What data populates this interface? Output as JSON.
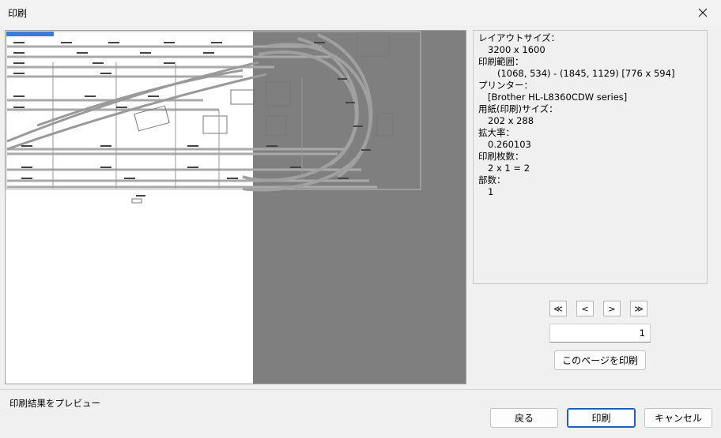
{
  "window": {
    "title": "印刷"
  },
  "info": {
    "layout_size_label": "レイアウトサイズ：",
    "layout_size_value": "3200 x 1600",
    "print_range_label": "印刷範囲：",
    "print_range_value": "(1068, 534) - (1845, 1129) [776 x 594]",
    "printer_label": "プリンター：",
    "printer_value": "[Brother HL-L8360CDW series]",
    "paper_size_label": "用紙(印刷)サイズ：",
    "paper_size_value": "202 x 288",
    "zoom_label": "拡大率：",
    "zoom_value": "0.260103",
    "sheets_label": "印刷枚数：",
    "sheets_value": "2 x 1 = 2",
    "copies_label": "部数：",
    "copies_value": "1"
  },
  "nav": {
    "first": "≪",
    "prev": "<",
    "next": ">",
    "last": "≫"
  },
  "page": {
    "value": "1"
  },
  "buttons": {
    "print_page": "このページを印刷",
    "back": "戻る",
    "print": "印刷",
    "cancel": "キャンセル"
  },
  "status": {
    "text": "印刷結果をプレビュー"
  }
}
